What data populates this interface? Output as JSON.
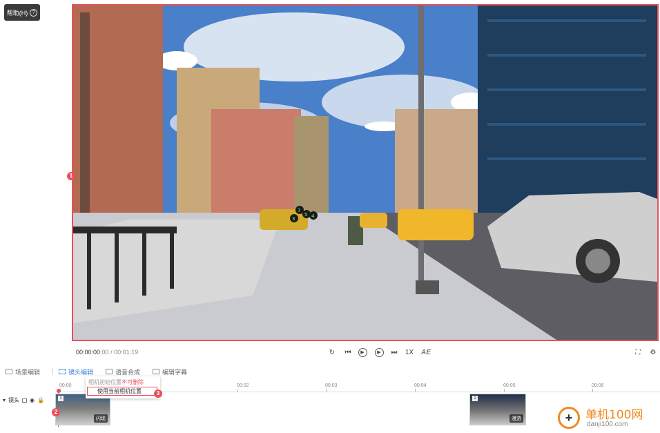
{
  "help": {
    "label": "帮助(H)",
    "icon": "question-circle-icon"
  },
  "viewport": {
    "markers": [
      "1",
      "2",
      "3"
    ],
    "scene_labels": [
      "7",
      "5",
      "4",
      "3"
    ]
  },
  "playback": {
    "current_time": "00:00:00",
    "current_frames": ":00",
    "duration": "/ 00:01:19",
    "speed": "1X",
    "ae_label": "AE"
  },
  "tabs": [
    {
      "label": "场景编辑",
      "icon": "scene-edit-icon"
    },
    {
      "label": "镜头编辑",
      "icon": "camera-edit-icon"
    },
    {
      "label": "语音合成",
      "icon": "voice-synthesis-icon"
    },
    {
      "label": "编辑字幕",
      "icon": "subtitle-icon"
    }
  ],
  "timeline": {
    "ticks": [
      "00:00",
      "00:02",
      "00:03",
      "00:04",
      "00:05",
      "00:06"
    ],
    "track_label": "镜头",
    "clips": [
      {
        "num": "1",
        "tag": "闪现"
      },
      {
        "num": "2",
        "tag": "漫游"
      }
    ]
  },
  "context_menu": {
    "item1_prefix": "相机初始位置",
    "item1_warning": "不可删除",
    "item2": "使用当前相机位置"
  },
  "watermark": {
    "cn": "单机100网",
    "url": "danji100.com"
  },
  "colors": {
    "accent": "#3a7bd5",
    "highlight": "#e8505b",
    "watermark": "#f08a1e"
  }
}
